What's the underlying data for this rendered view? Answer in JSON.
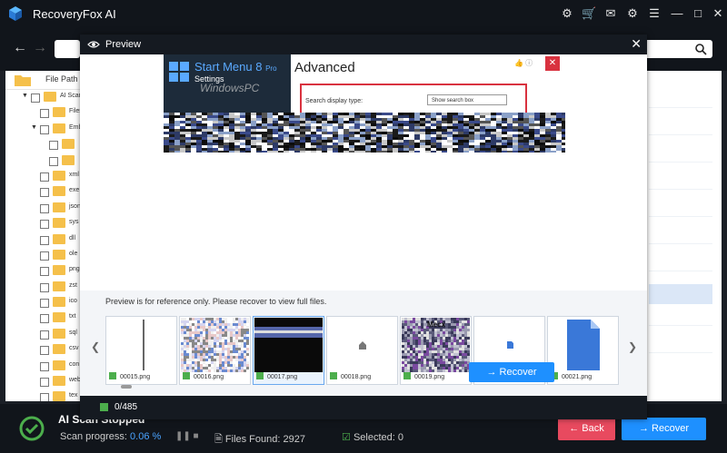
{
  "app": {
    "title": "RecoveryFox AI"
  },
  "toolbar": {
    "back_icon": "arrow-left",
    "forward_icon": "arrow-right",
    "search_icon": "search"
  },
  "left": {
    "header": "File Path",
    "items": [
      {
        "label": "AI Scan",
        "level": 1,
        "expanded": true
      },
      {
        "label": "Files",
        "level": 2
      },
      {
        "label": "Emb",
        "level": 2,
        "expanded": true
      },
      {
        "label": "",
        "level": 3
      },
      {
        "label": "",
        "level": 3
      },
      {
        "label": "xml",
        "level": 2
      },
      {
        "label": "exe",
        "level": 2
      },
      {
        "label": "json",
        "level": 2
      },
      {
        "label": "sys",
        "level": 2
      },
      {
        "label": "dll",
        "level": 2
      },
      {
        "label": "ole",
        "level": 2
      },
      {
        "label": "png",
        "level": 2
      },
      {
        "label": "zst",
        "level": 2
      },
      {
        "label": "ico",
        "level": 2
      },
      {
        "label": "txt",
        "level": 2
      },
      {
        "label": "sql",
        "level": 2
      },
      {
        "label": "csv",
        "level": 2
      },
      {
        "label": "con",
        "level": 2
      },
      {
        "label": "web",
        "level": 2
      },
      {
        "label": "tex",
        "level": 2
      }
    ]
  },
  "preview": {
    "title": "Preview",
    "shot": {
      "app_title": "Start Menu 8",
      "app_edition": "Pro",
      "app_sub": "Settings",
      "watermark": "WindowsPC",
      "heading": "Advanced",
      "field_label": "Search display type:",
      "field_value": "Show search box"
    },
    "note": "Preview is for reference only. Please recover to view full files.",
    "thumbnails": [
      {
        "name": "00015.png",
        "kind": "line"
      },
      {
        "name": "00016.png",
        "kind": "noise"
      },
      {
        "name": "00017.png",
        "kind": "dark",
        "selected": true
      },
      {
        "name": "00018.png",
        "kind": "home"
      },
      {
        "name": "00019.png",
        "kind": "noise2",
        "text": "Mecx"
      },
      {
        "name": "00020.png",
        "kind": "smallfile"
      },
      {
        "name": "00021.png",
        "kind": "bigfile"
      }
    ],
    "selected_count": "0/485",
    "recover_label": "Recover"
  },
  "status": {
    "title": "AI Scan Stopped",
    "progress_label": "Scan progress:",
    "progress_value": "0.06 %",
    "files_found": "Files Found: 2927",
    "selected": "Selected: 0"
  },
  "buttons": {
    "back": "Back",
    "recover": "Recover"
  },
  "colors": {
    "accent": "#1e90ff",
    "back": "#e84a5f",
    "check": "#4cae4c",
    "titlebar": "#11151b"
  }
}
